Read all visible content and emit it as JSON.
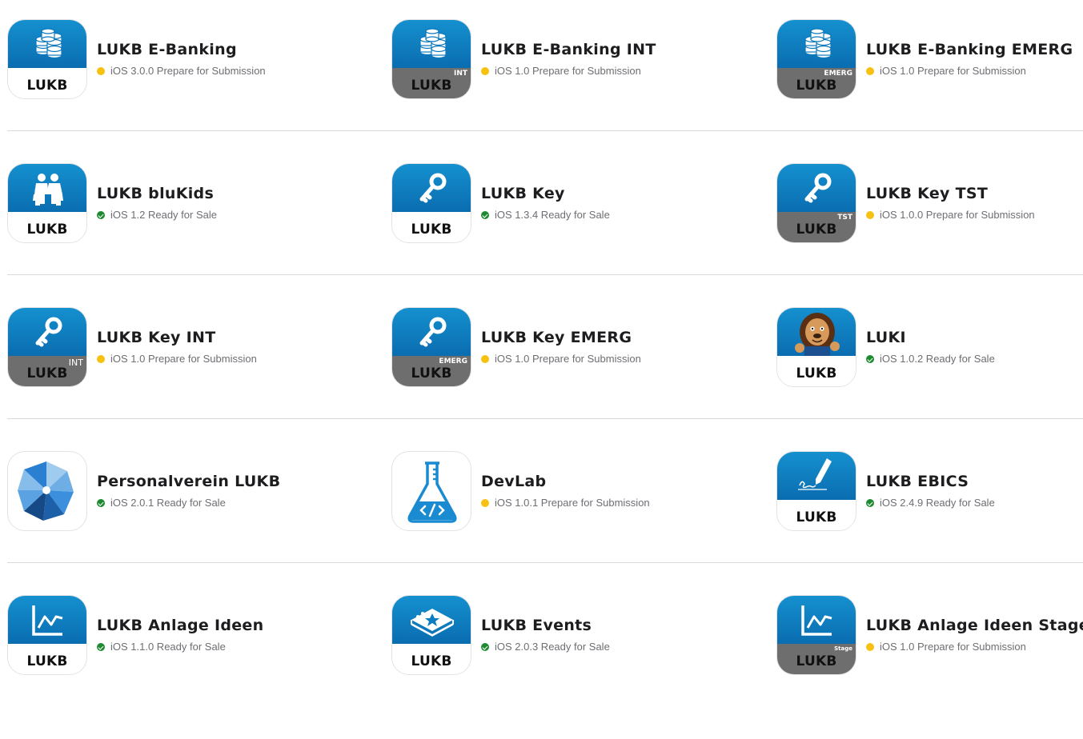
{
  "brand_label": "LUKB",
  "colors": {
    "icon_blue": "#0a7dc2",
    "icon_gray_band": "#6e6e6e",
    "status_prepare": "#f6c111",
    "status_ready": "#1d8a30"
  },
  "apps": [
    [
      {
        "name": "LUKB E-Banking",
        "status": "iOS 3.0.0 Prepare for Submission",
        "state": "prepare",
        "icon": "coins-stack-icon",
        "variant": ""
      },
      {
        "name": "LUKB E-Banking INT",
        "status": "iOS 1.0 Prepare for Submission",
        "state": "prepare",
        "icon": "coins-stack-icon",
        "variant": "INT"
      },
      {
        "name": "LUKB E-Banking EMERG",
        "status": "iOS 1.0 Prepare for Submission",
        "state": "prepare",
        "icon": "coins-stack-icon",
        "variant": "EMERG"
      }
    ],
    [
      {
        "name": "LUKB bluKids",
        "status": "iOS 1.2 Ready for Sale",
        "state": "ready",
        "icon": "family-icon",
        "variant": ""
      },
      {
        "name": "LUKB Key",
        "status": "iOS 1.3.4 Ready for Sale",
        "state": "ready",
        "icon": "key-icon",
        "variant": ""
      },
      {
        "name": "LUKB Key TST",
        "status": "iOS 1.0.0 Prepare for Submission",
        "state": "prepare",
        "icon": "key-icon",
        "variant": "TST"
      }
    ],
    [
      {
        "name": "LUKB Key INT",
        "status": "iOS 1.0 Prepare for Submission",
        "state": "prepare",
        "icon": "key-icon",
        "variant": "INT"
      },
      {
        "name": "LUKB Key EMERG",
        "status": "iOS 1.0 Prepare for Submission",
        "state": "prepare",
        "icon": "key-icon",
        "variant": "EMERG"
      },
      {
        "name": "LUKI",
        "status": "iOS 1.0.2 Ready for Sale",
        "state": "ready",
        "icon": "lion-mascot-icon",
        "variant": ""
      }
    ],
    [
      {
        "name": "Personalverein LUKB",
        "status": "iOS 2.0.1 Ready for Sale",
        "state": "ready",
        "icon": "pinwheel-icon",
        "variant": ""
      },
      {
        "name": "DevLab",
        "status": "iOS 1.0.1 Prepare for Submission",
        "state": "prepare",
        "icon": "flask-code-icon",
        "variant": ""
      },
      {
        "name": "LUKB EBICS",
        "status": "iOS 2.4.9 Ready for Sale",
        "state": "ready",
        "icon": "pen-signature-icon",
        "variant": ""
      }
    ],
    [
      {
        "name": "LUKB Anlage Ideen",
        "status": "iOS 1.1.0 Ready for Sale",
        "state": "ready",
        "icon": "line-chart-icon",
        "variant": ""
      },
      {
        "name": "LUKB Events",
        "status": "iOS 2.0.3 Ready for Sale",
        "state": "ready",
        "icon": "ticket-star-icon",
        "variant": ""
      },
      {
        "name": "LUKB Anlage Ideen Stage",
        "status": "iOS 1.0 Prepare for Submission",
        "state": "prepare",
        "icon": "line-chart-icon",
        "variant": "Stage"
      }
    ]
  ]
}
